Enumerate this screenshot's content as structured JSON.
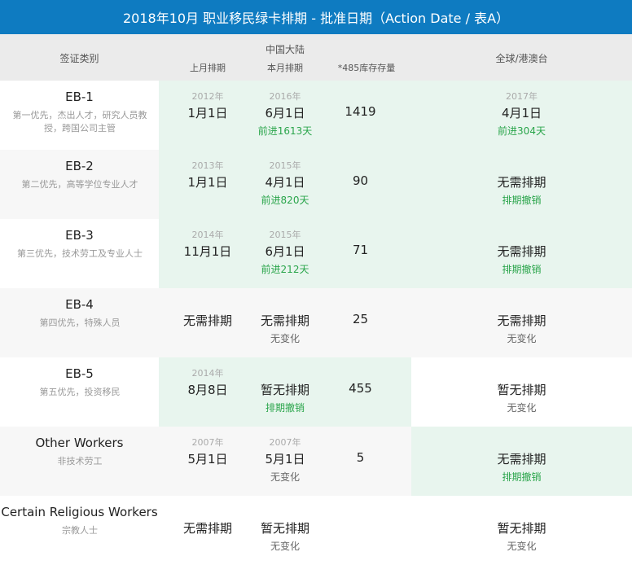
{
  "title": "2018年10月 职业移民绿卡排期 - 批准日期（Action Date / 表A）",
  "header": {
    "category": "签证类别",
    "china_mainland": "中国大陆",
    "last_month": "上月排期",
    "this_month": "本月排期",
    "stock": "*485库存存量",
    "global": "全球/港澳台"
  },
  "colors": {
    "title_bg": "#0e7bc1",
    "header_bg": "#ebebeb",
    "highlight": "#e8f5ee",
    "alt_row": "#f7f7f7",
    "advance_text": "#2aa54b"
  },
  "rows": [
    {
      "name": "EB-1",
      "desc": "第一优先，杰出人才，研究人员教授，跨国公司主管",
      "last": {
        "year": "2012年",
        "date": "1月1日"
      },
      "this": {
        "year": "2016年",
        "date": "6月1日",
        "note": "前进1613天"
      },
      "stock": "1419",
      "global": {
        "year": "2017年",
        "date": "4月1日",
        "note": "前进304天"
      }
    },
    {
      "name": "EB-2",
      "desc": "第二优先，高等学位专业人才",
      "last": {
        "year": "2013年",
        "date": "1月1日"
      },
      "this": {
        "year": "2015年",
        "date": "4月1日",
        "note": "前进820天"
      },
      "stock": "90",
      "global": {
        "year": "",
        "date": "无需排期",
        "note": "排期撤销"
      }
    },
    {
      "name": "EB-3",
      "desc": "第三优先，技术劳工及专业人士",
      "last": {
        "year": "2014年",
        "date": "11月1日"
      },
      "this": {
        "year": "2015年",
        "date": "6月1日",
        "note": "前进212天"
      },
      "stock": "71",
      "global": {
        "year": "",
        "date": "无需排期",
        "note": "排期撤销"
      }
    },
    {
      "name": "EB-4",
      "desc": "第四优先，特殊人员",
      "last": {
        "year": "",
        "date": "无需排期"
      },
      "this": {
        "year": "",
        "date": "无需排期",
        "note": "无变化"
      },
      "stock": "25",
      "global": {
        "year": "",
        "date": "无需排期",
        "note": "无变化"
      }
    },
    {
      "name": "EB-5",
      "desc": "第五优先，投资移民",
      "last": {
        "year": "2014年",
        "date": "8月8日"
      },
      "this": {
        "year": "",
        "date": "暂无排期",
        "note": "排期撤销"
      },
      "stock": "455",
      "global": {
        "year": "",
        "date": "暂无排期",
        "note": "无变化"
      }
    },
    {
      "name": "Other Workers",
      "desc": "非技术劳工",
      "last": {
        "year": "2007年",
        "date": "5月1日"
      },
      "this": {
        "year": "2007年",
        "date": "5月1日",
        "note": "无变化"
      },
      "stock": "5",
      "global": {
        "year": "",
        "date": "无需排期",
        "note": "排期撤销"
      }
    },
    {
      "name": "Certain Religious Workers",
      "desc": "宗教人士",
      "last": {
        "year": "",
        "date": "无需排期"
      },
      "this": {
        "year": "",
        "date": "暂无排期",
        "note": "无变化"
      },
      "stock": "",
      "global": {
        "year": "",
        "date": "暂无排期",
        "note": "无变化"
      }
    }
  ]
}
